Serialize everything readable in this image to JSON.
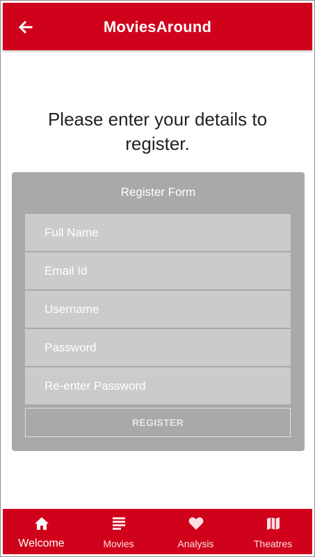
{
  "header": {
    "title": "MoviesAround",
    "back_icon": "arrow-left-icon"
  },
  "main": {
    "prompt": "Please enter your details to register."
  },
  "form": {
    "title": "Register Form",
    "fields": [
      {
        "placeholder": "Full Name",
        "value": ""
      },
      {
        "placeholder": "Email Id",
        "value": ""
      },
      {
        "placeholder": "Username",
        "value": ""
      },
      {
        "placeholder": "Password",
        "value": ""
      },
      {
        "placeholder": "Re-enter Password",
        "value": ""
      }
    ],
    "submit_label": "REGISTER"
  },
  "tabs": [
    {
      "label": "Welcome",
      "icon": "home-icon",
      "active": true
    },
    {
      "label": "Movies",
      "icon": "list-icon",
      "active": false
    },
    {
      "label": "Analysis",
      "icon": "heart-icon",
      "active": false
    },
    {
      "label": "Theatres",
      "icon": "map-icon",
      "active": false
    }
  ],
  "colors": {
    "brand": "#d0021b",
    "card": "#a7a9ab",
    "field": "#c9cbcd"
  }
}
